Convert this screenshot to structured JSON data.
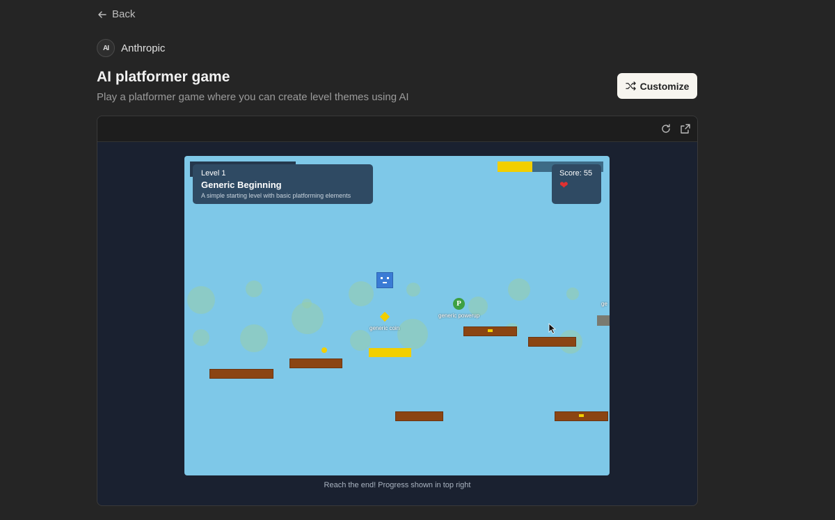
{
  "nav": {
    "back_label": "Back"
  },
  "org": {
    "logo_text": "AI",
    "name": "Anthropic"
  },
  "header": {
    "title": "AI platformer game",
    "subtitle": "Play a platformer game where you can create level themes using AI",
    "customize_label": "Customize"
  },
  "game": {
    "level_number": "Level 1",
    "level_name": "Generic Beginning",
    "level_description": "A simple starting level with basic platforming elements",
    "score": "Score: 55",
    "lives_icon": "heart-icon",
    "progress": 0.33,
    "labels": {
      "coin": "generic coin",
      "powerup": "generic powerup",
      "powerup_glyph": "P",
      "edge": "ge"
    },
    "caption": "Reach the end! Progress shown in top right"
  },
  "colors": {
    "background": "#252525",
    "sky": "#7ec8e8",
    "platform": "#8b4513",
    "coin": "#f2cf00",
    "player": "#3a7bd5",
    "powerup": "#3ea043",
    "panel": "#2f4a63"
  }
}
